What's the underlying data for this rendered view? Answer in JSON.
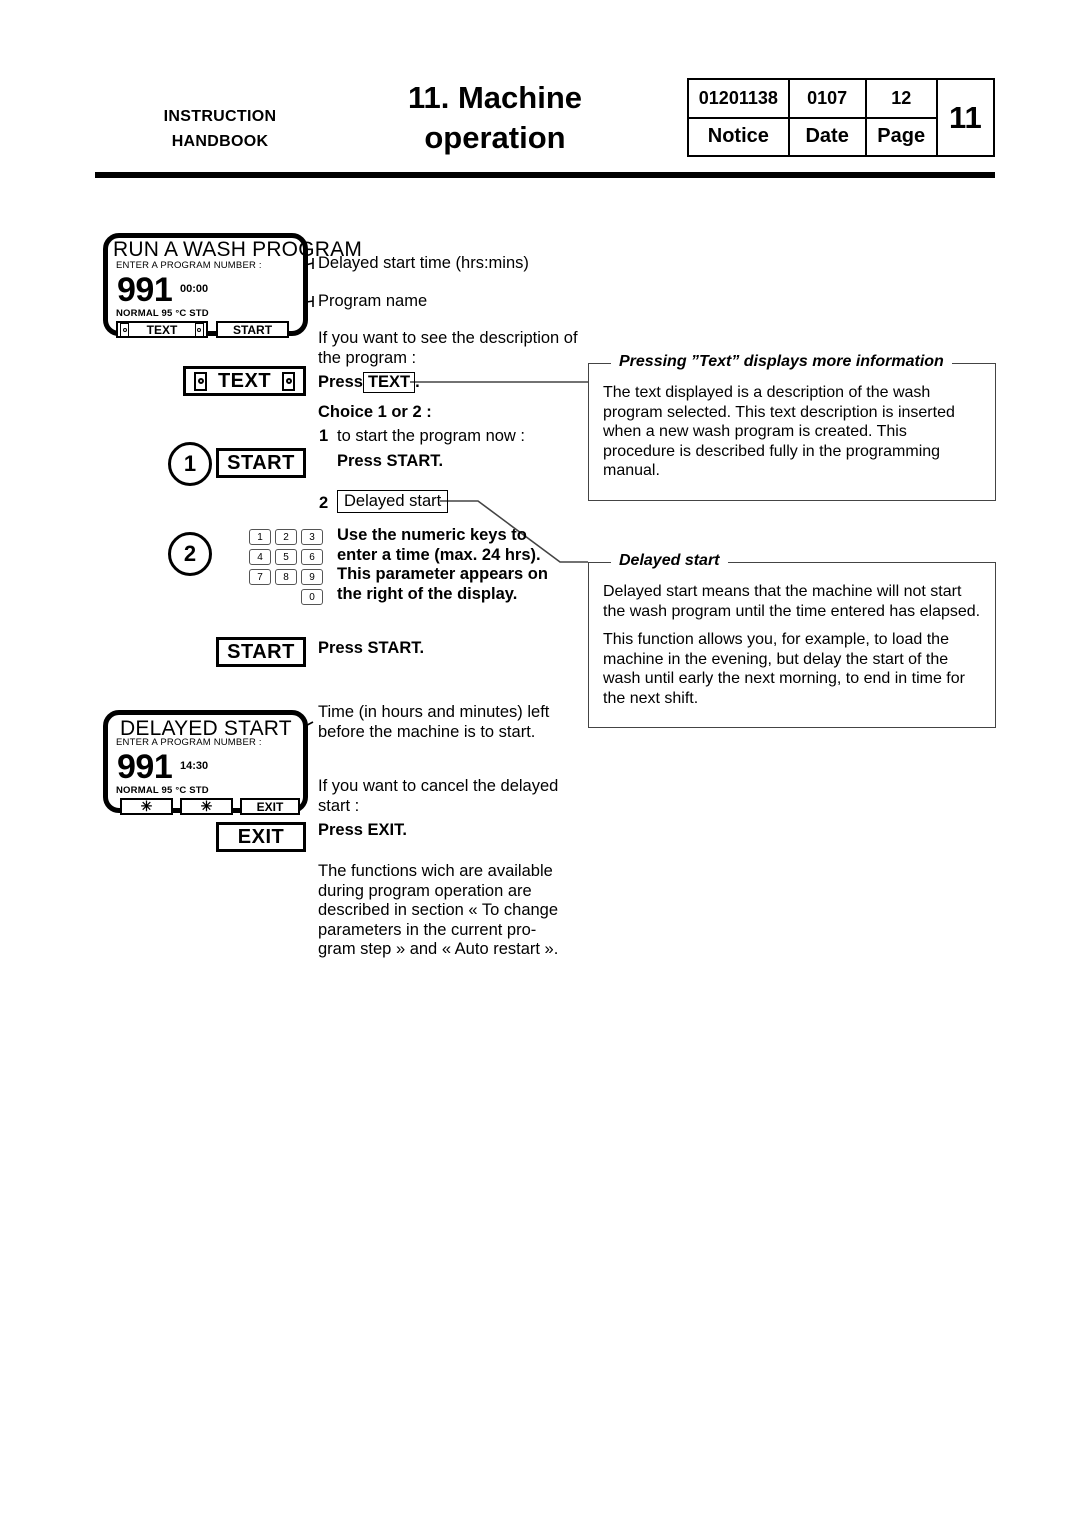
{
  "header": {
    "left_line1": "INSTRUCTION",
    "left_line2": "HANDBOOK",
    "title_line1": "11. Machine",
    "title_line2": "operation",
    "table": {
      "notice_value": "01201138",
      "date_value": "0107",
      "page_value": "12",
      "notice_label": "Notice",
      "date_label": "Date",
      "page_label": "Page",
      "chapter": "11"
    }
  },
  "panel_run": {
    "title": "RUN A WASH PROGRAM",
    "subtitle": "ENTER A PROGRAM NUMBER :",
    "number": "991",
    "time": "00:00",
    "program": "NORMAL 95 °C STD",
    "button_text": "TEXT",
    "button_start": "START"
  },
  "panel_delayed": {
    "title": "DELAYED START",
    "subtitle": "ENTER A PROGRAM NUMBER :",
    "number": "991",
    "time": "14:30",
    "program": "NORMAL 95 °C STD",
    "button_star1": "✳",
    "button_star2": "✳",
    "button_exit": "EXIT"
  },
  "keys": {
    "text": "TEXT",
    "start_1": "START",
    "start_2": "START",
    "exit": "EXIT",
    "circle_1": "1",
    "circle_2": "2",
    "keypad": [
      [
        "1",
        "2",
        "3"
      ],
      [
        "4",
        "5",
        "6"
      ],
      [
        "7",
        "8",
        "9"
      ],
      [
        "0"
      ]
    ]
  },
  "callouts": {
    "delayed_start_time": "Delayed start time (hrs:mins)",
    "program_name": "Program name",
    "time_left": "Time (in hours and minutes) left before the machine is to start."
  },
  "instructions": {
    "see_description": "If you want to see the description of the program :",
    "press_prefix": "Press",
    "press_text_key": "TEXT",
    "press_suffix": ".",
    "choice": "Choice 1 or 2 :",
    "step1_num": "1",
    "step1_text": "to start the program now :",
    "step1_action": "Press START.",
    "step2_num": "2",
    "step2_label": "Delayed start",
    "step2_body": "Use the numeric keys to enter a time (max. 24 hrs). This parameter appears on the right of the display.",
    "press_start": "Press START.",
    "cancel_delayed": "If you want to cancel the delayed start :",
    "press_exit": "Press EXIT.",
    "functions_note": "The functions wich are available during program operation are described in section « To change parameters in the current pro-gram step » and « Auto restart »."
  },
  "infobox_text": {
    "legend": "Pressing ”Text” displays more information",
    "paragraph": "The text displayed is a description of the wash program selected. This text description is inserted when a new wash program is created. This procedure is described fully in the programming manual."
  },
  "infobox_delayed": {
    "legend": "Delayed start",
    "paragraph1": "Delayed start means that the machine will not start the wash program until the time entered has elapsed.",
    "paragraph2": "This function allows you, for example, to load the machine in the evening, but delay the start of the wash until early the next morning, to end in time for the next shift."
  }
}
